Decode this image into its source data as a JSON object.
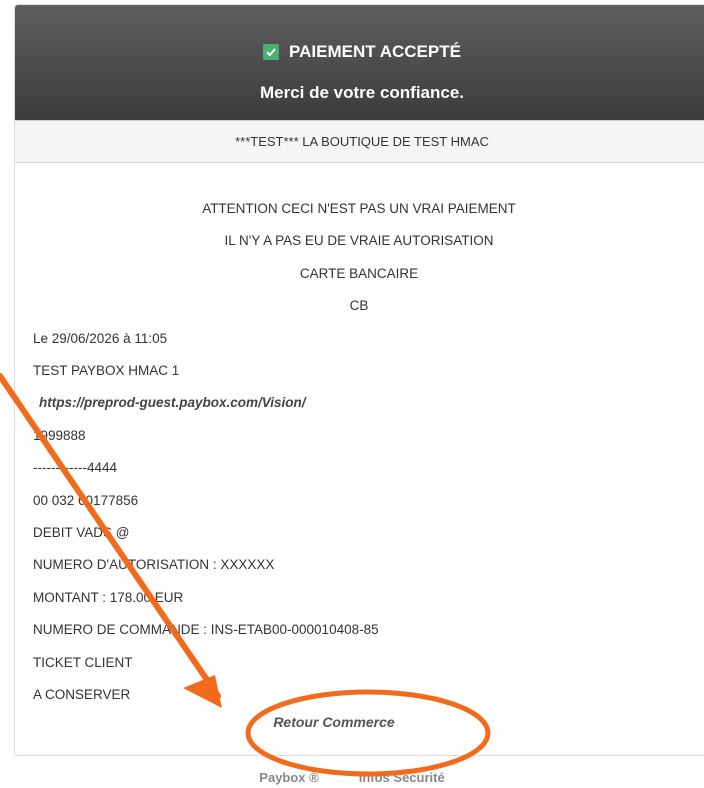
{
  "header": {
    "status": "PAIEMENT ACCEPTÉ",
    "thanks": "Merci de votre confiance."
  },
  "merchant": "***TEST*** LA BOUTIQUE DE TEST HMAC",
  "ticket": {
    "warning1": "ATTENTION CECI N'EST PAS UN VRAI PAIEMENT",
    "warning2": "IL N'Y A PAS EU DE VRAIE AUTORISATION",
    "card_type": "CARTE BANCAIRE",
    "card_code": "CB",
    "date_line": "Le 29/06/2026 à 11:05",
    "shop_name": "TEST PAYBOX HMAC 1",
    "url": "https://preprod-guest.paybox.com/Vision/",
    "site_id": "1999888",
    "card_number": "------------4444",
    "ref_line": "00 032 60177856",
    "debit_line": "DEBIT VADS @",
    "auth_line": "NUMERO D'AUTORISATION : XXXXXX",
    "amount_line": "MONTANT : 178.00 EUR",
    "order_line": "NUMERO DE COMMANDE : INS-ETAB00-000010408-85",
    "ticket_client": "TICKET CLIENT",
    "keep": "A CONSERVER"
  },
  "actions": {
    "retour": "Retour Commerce"
  },
  "footer": {
    "brand": "Paybox ®",
    "security": "Infos Sécurité"
  },
  "annotation": {
    "color": "#f26b1d"
  },
  "colors": {
    "header_bg": "#4a4a4a",
    "check_green": "#4caf72"
  }
}
